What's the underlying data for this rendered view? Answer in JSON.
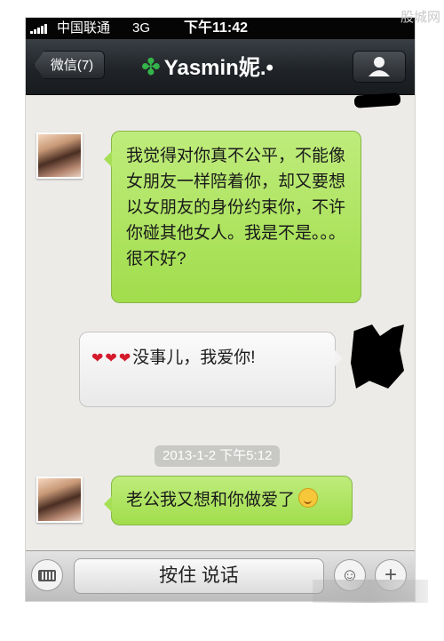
{
  "status_bar": {
    "carrier": "中国联通",
    "network": "3G",
    "time": "下午11:42"
  },
  "watermark": "股城网",
  "nav": {
    "back_label": "微信(7)",
    "title": "Yasmin妮.•",
    "title_icon": "clover-icon",
    "profile_icon": "person-icon"
  },
  "messages": [
    {
      "sender": "contact",
      "style": "green",
      "text": "我觉得对你真不公平，不能像女朋友一样陪着你，却又要想以女朋友的身份约束你，不许你碰其他女人。我是不是。。。很不好?"
    },
    {
      "sender": "self",
      "style": "white",
      "prefix_emoji": "❤❤❤",
      "text": "没事儿，我爱你!"
    },
    {
      "sender": "contact",
      "style": "green",
      "text": "老公我又想和你做爱了",
      "suffix_emoji": "blush-smiley-icon"
    }
  ],
  "timestamp": "2013-1-2 下午5:12",
  "input_bar": {
    "hold_to_talk_label": "按住 说话",
    "keyboard_icon": "keyboard-icon",
    "emoji_icon": "smiley-icon",
    "more_icon": "plus-icon"
  }
}
